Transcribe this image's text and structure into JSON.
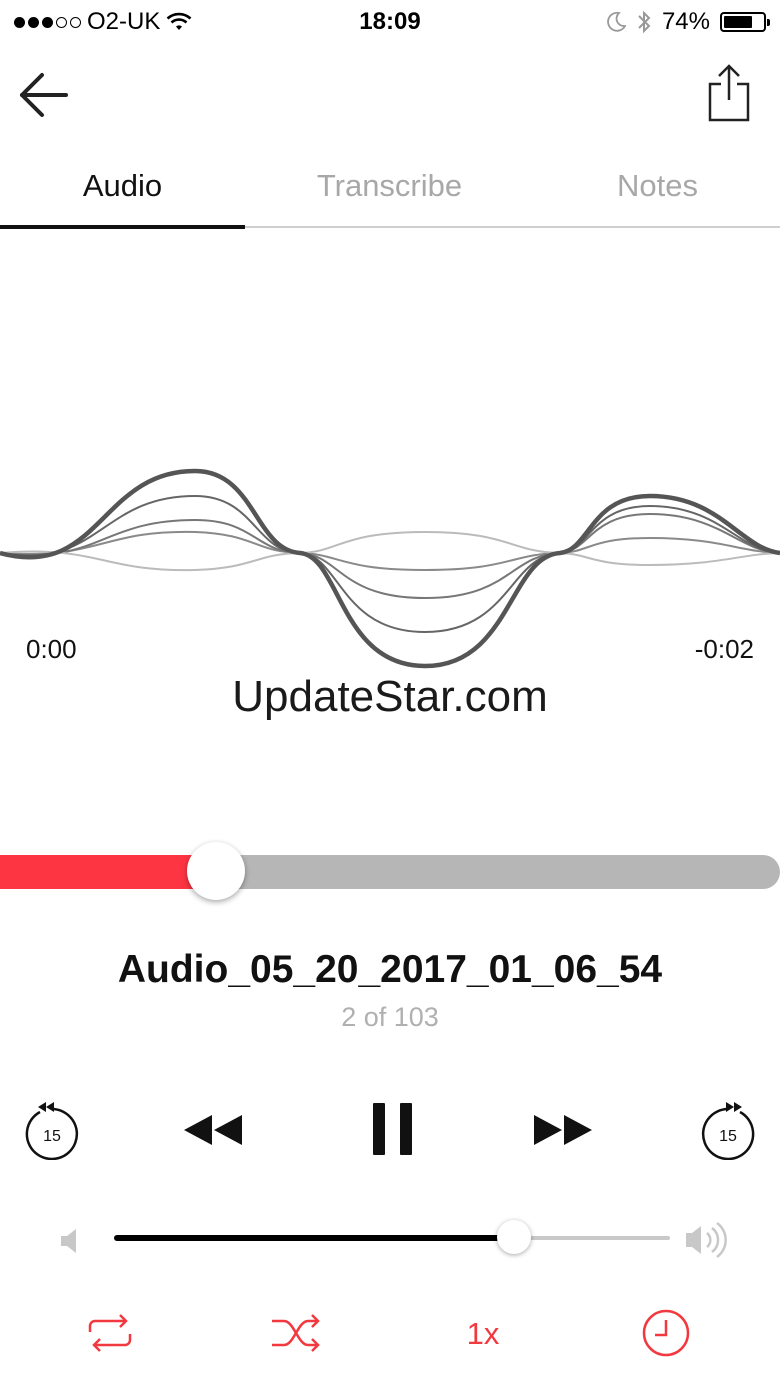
{
  "status_bar": {
    "carrier": "O2-UK",
    "time": "18:09",
    "battery_text": "74%",
    "battery_level": 0.74,
    "icons": [
      "signal-dots-icon",
      "wifi-icon",
      "moon-icon",
      "bluetooth-icon",
      "battery-icon"
    ]
  },
  "header": {
    "back_icon": "arrow-left-icon",
    "share_icon": "share-icon"
  },
  "tabs": [
    {
      "label": "Audio",
      "active": true
    },
    {
      "label": "Transcribe",
      "active": false
    },
    {
      "label": "Notes",
      "active": false
    }
  ],
  "player": {
    "elapsed": "0:00",
    "remaining": "-0:02",
    "watermark": "UpdateStar.com",
    "progress": 0.277,
    "track_title": "Audio_05_20_2017_01_06_54",
    "track_position": "2 of 103",
    "skip_back_seconds": "15",
    "skip_forward_seconds": "15",
    "volume": 0.72,
    "speed": "1x"
  },
  "colors": {
    "accent": "#fd3542",
    "accent_icons": "#f2393f",
    "track": "#b6b6b6",
    "inactive_tab": "#a8a8a8",
    "wave_primary": "#555555"
  }
}
